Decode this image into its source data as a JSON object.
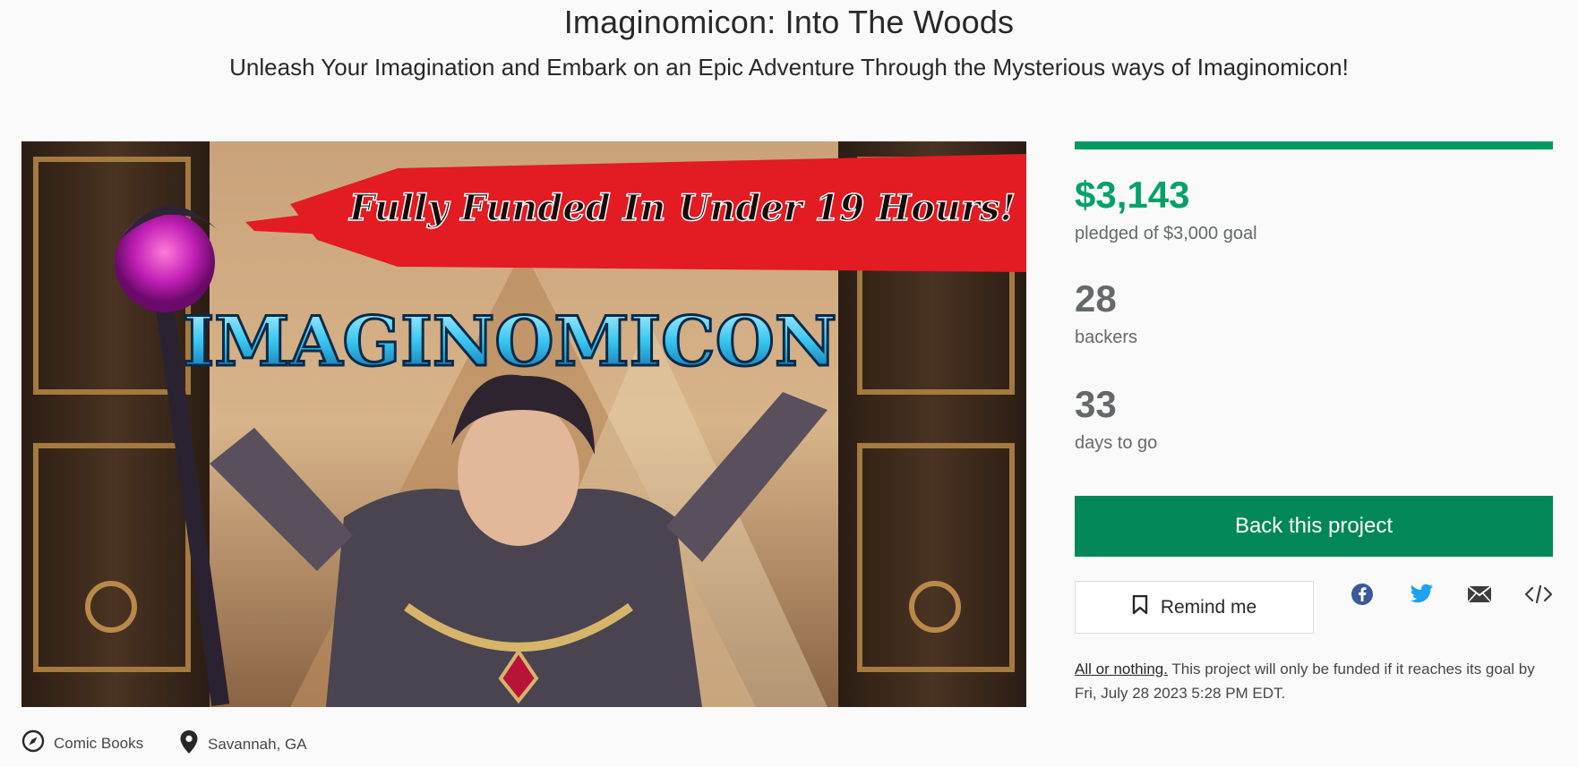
{
  "header": {
    "title": "Imaginomicon: Into The Woods",
    "subtitle": "Unleash Your Imagination and Embark on an Epic Adventure Through the Mysterious ways of Imaginomicon!"
  },
  "hero": {
    "banner_text": "Fully Funded In Under 19 Hours!",
    "logo_text": "IMAGINOMICON"
  },
  "stats": {
    "progress_fraction": 1.0,
    "pledged_amount": "$3,143",
    "pledged_label": "pledged of $3,000 goal",
    "backers_count": "28",
    "backers_label": "backers",
    "days_count": "33",
    "days_label": "days to go"
  },
  "actions": {
    "back_label": "Back this project",
    "remind_label": "Remind me",
    "share_icons": [
      "facebook-icon",
      "twitter-icon",
      "mail-icon",
      "embed-icon"
    ]
  },
  "funding_note": {
    "link_text": "All or nothing.",
    "text": " This project will only be funded if it reaches its goal by Fri, July 28 2023 5:28 PM EDT."
  },
  "meta": {
    "category": "Comic Books",
    "location": "Savannah, GA"
  },
  "colors": {
    "accent_green": "#028858",
    "pledged_green": "#05a16b",
    "banner_red": "#e31b23"
  }
}
